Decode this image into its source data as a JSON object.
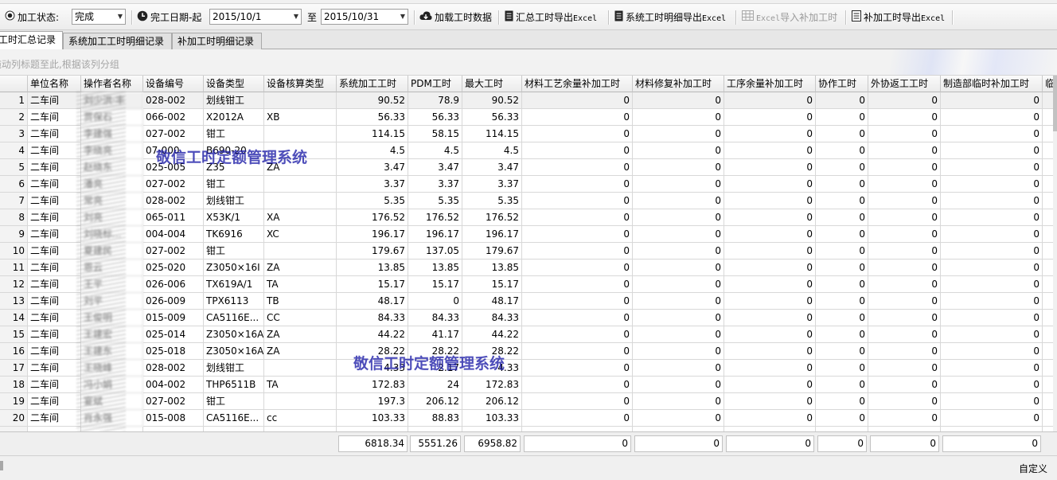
{
  "toolbar": {
    "status_label": "加工状态:",
    "status_value": "完成",
    "date_label": "完工日期-起",
    "date_from": "2015/10/1",
    "date_to_label": "至",
    "date_to": "2015/10/31",
    "load_button": "加载工时数据",
    "export_summary_button": "汇总工时导出Excel",
    "export_system_button": "系统工时明细导出Excel",
    "import_button": "Excel导入补加工时",
    "export_extra_button": "补加工时导出Excel"
  },
  "tabs": [
    "工时汇总记录",
    "系统加工工时明细记录",
    "补加工时明细记录"
  ],
  "group_panel_hint": "拖动列标题至此,根据该列分组",
  "watermark": "敬信工时定额管理系统",
  "columns": [
    "单位名称",
    "操作者名称",
    "设备编号",
    "设备类型",
    "设备核算类型",
    "系统加工工时",
    "PDM工时",
    "最大工时",
    "材料工艺余量补加工时",
    "材料修复补加工时",
    "工序余量补加工时",
    "协作工时",
    "外协返工工时",
    "制造部临时补加工时",
    "临"
  ],
  "rows": [
    {
      "n": "1",
      "unit": "二车间",
      "op": "刘少洪·丰",
      "dev": "028-002",
      "type": "划线钳工",
      "acct": "",
      "sys": "90.52",
      "pdm": "78.9",
      "max": "90.52",
      "c1": "0",
      "c2": "0",
      "c3": "0",
      "c4": "0",
      "c5": "0",
      "c6": "0"
    },
    {
      "n": "2",
      "unit": "二车间",
      "op": "贾保石",
      "dev": "066-002",
      "type": "X2012A",
      "acct": "XB",
      "sys": "56.33",
      "pdm": "56.33",
      "max": "56.33",
      "c1": "0",
      "c2": "0",
      "c3": "0",
      "c4": "0",
      "c5": "0",
      "c6": "0"
    },
    {
      "n": "3",
      "unit": "二车间",
      "op": "李建强",
      "dev": "027-002",
      "type": "钳工",
      "acct": "",
      "sys": "114.15",
      "pdm": "58.15",
      "max": "114.15",
      "c1": "0",
      "c2": "0",
      "c3": "0",
      "c4": "0",
      "c5": "0",
      "c6": "0"
    },
    {
      "n": "4",
      "unit": "二车间",
      "op": "李晓亮",
      "dev": "07-000",
      "type": "B690-20",
      "acct": "",
      "sys": "4.5",
      "pdm": "4.5",
      "max": "4.5",
      "c1": "0",
      "c2": "0",
      "c3": "0",
      "c4": "0",
      "c5": "0",
      "c6": "0"
    },
    {
      "n": "5",
      "unit": "二车间",
      "op": "赵晓东",
      "dev": "025-005",
      "type": "Z35",
      "acct": "ZA",
      "sys": "3.47",
      "pdm": "3.47",
      "max": "3.47",
      "c1": "0",
      "c2": "0",
      "c3": "0",
      "c4": "0",
      "c5": "0",
      "c6": "0"
    },
    {
      "n": "6",
      "unit": "二车间",
      "op": "潘亮",
      "dev": "027-002",
      "type": "钳工",
      "acct": "",
      "sys": "3.37",
      "pdm": "3.37",
      "max": "3.37",
      "c1": "0",
      "c2": "0",
      "c3": "0",
      "c4": "0",
      "c5": "0",
      "c6": "0"
    },
    {
      "n": "7",
      "unit": "二车间",
      "op": "常亮",
      "dev": "028-002",
      "type": "划线钳工",
      "acct": "",
      "sys": "5.35",
      "pdm": "5.35",
      "max": "5.35",
      "c1": "0",
      "c2": "0",
      "c3": "0",
      "c4": "0",
      "c5": "0",
      "c6": "0"
    },
    {
      "n": "8",
      "unit": "二车间",
      "op": "刘亮",
      "dev": "065-011",
      "type": "X53K/1",
      "acct": "XA",
      "sys": "176.52",
      "pdm": "176.52",
      "max": "176.52",
      "c1": "0",
      "c2": "0",
      "c3": "0",
      "c4": "0",
      "c5": "0",
      "c6": "0"
    },
    {
      "n": "9",
      "unit": "二车间",
      "op": "刘晓标...",
      "dev": "004-004",
      "type": "TK6916",
      "acct": "XC",
      "sys": "196.17",
      "pdm": "196.17",
      "max": "196.17",
      "c1": "0",
      "c2": "0",
      "c3": "0",
      "c4": "0",
      "c5": "0",
      "c6": "0"
    },
    {
      "n": "10",
      "unit": "二车间",
      "op": "夏建民",
      "dev": "027-002",
      "type": "钳工",
      "acct": "",
      "sys": "179.67",
      "pdm": "137.05",
      "max": "179.67",
      "c1": "0",
      "c2": "0",
      "c3": "0",
      "c4": "0",
      "c5": "0",
      "c6": "0"
    },
    {
      "n": "11",
      "unit": "二车间",
      "op": "恩云",
      "dev": "025-020",
      "type": "Z3050×16I",
      "acct": "ZA",
      "sys": "13.85",
      "pdm": "13.85",
      "max": "13.85",
      "c1": "0",
      "c2": "0",
      "c3": "0",
      "c4": "0",
      "c5": "0",
      "c6": "0"
    },
    {
      "n": "12",
      "unit": "二车间",
      "op": "王平",
      "dev": "026-006",
      "type": "TX619A/1",
      "acct": "TA",
      "sys": "15.17",
      "pdm": "15.17",
      "max": "15.17",
      "c1": "0",
      "c2": "0",
      "c3": "0",
      "c4": "0",
      "c5": "0",
      "c6": "0"
    },
    {
      "n": "13",
      "unit": "二车间",
      "op": "刘平",
      "dev": "026-009",
      "type": "TPX6113",
      "acct": "TB",
      "sys": "48.17",
      "pdm": "0",
      "max": "48.17",
      "c1": "0",
      "c2": "0",
      "c3": "0",
      "c4": "0",
      "c5": "0",
      "c6": "0"
    },
    {
      "n": "14",
      "unit": "二车间",
      "op": "王俊明",
      "dev": "015-009",
      "type": "CA5116E...",
      "acct": "CC",
      "sys": "84.33",
      "pdm": "84.33",
      "max": "84.33",
      "c1": "0",
      "c2": "0",
      "c3": "0",
      "c4": "0",
      "c5": "0",
      "c6": "0"
    },
    {
      "n": "15",
      "unit": "二车间",
      "op": "王建宏",
      "dev": "025-014",
      "type": "Z3050×16A",
      "acct": "ZA",
      "sys": "44.22",
      "pdm": "41.17",
      "max": "44.22",
      "c1": "0",
      "c2": "0",
      "c3": "0",
      "c4": "0",
      "c5": "0",
      "c6": "0"
    },
    {
      "n": "16",
      "unit": "二车间",
      "op": "王建东",
      "dev": "025-018",
      "type": "Z3050×16A",
      "acct": "ZA",
      "sys": "28.22",
      "pdm": "28.22",
      "max": "28.22",
      "c1": "0",
      "c2": "0",
      "c3": "0",
      "c4": "0",
      "c5": "0",
      "c6": "0"
    },
    {
      "n": "17",
      "unit": "二车间",
      "op": "王晓峰",
      "dev": "028-002",
      "type": "划线钳工",
      "acct": "",
      "sys": "4.33",
      "pdm": "2.17",
      "max": "4.33",
      "c1": "0",
      "c2": "0",
      "c3": "0",
      "c4": "0",
      "c5": "0",
      "c6": "0"
    },
    {
      "n": "18",
      "unit": "二车间",
      "op": "冯小娟",
      "dev": "004-002",
      "type": "THP6511B",
      "acct": "TA",
      "sys": "172.83",
      "pdm": "24",
      "max": "172.83",
      "c1": "0",
      "c2": "0",
      "c3": "0",
      "c4": "0",
      "c5": "0",
      "c6": "0"
    },
    {
      "n": "19",
      "unit": "二车间",
      "op": "宴斌",
      "dev": "027-002",
      "type": "钳工",
      "acct": "",
      "sys": "197.3",
      "pdm": "206.12",
      "max": "206.12",
      "c1": "0",
      "c2": "0",
      "c3": "0",
      "c4": "0",
      "c5": "0",
      "c6": "0"
    },
    {
      "n": "20",
      "unit": "二车间",
      "op": "肖永强",
      "dev": "015-008",
      "type": "CA5116E...",
      "acct": "cc",
      "sys": "103.33",
      "pdm": "88.83",
      "max": "103.33",
      "c1": "0",
      "c2": "0",
      "c3": "0",
      "c4": "0",
      "c5": "0",
      "c6": "0"
    }
  ],
  "totals": {
    "sys": "6818.34",
    "pdm": "5551.26",
    "max": "6958.82",
    "c1": "0",
    "c2": "0",
    "c3": "0",
    "c4": "0",
    "c5": "0",
    "c6": "0"
  },
  "statusbar": {
    "right_label": "自定义"
  }
}
